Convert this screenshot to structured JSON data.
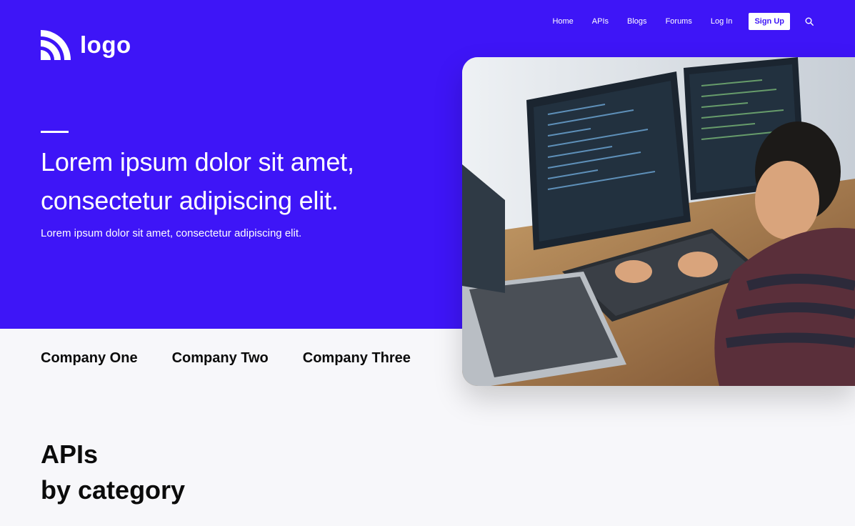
{
  "logo": {
    "text": "logo",
    "icon": "rss-logo-icon"
  },
  "nav": {
    "items": [
      "Home",
      "APIs",
      "Blogs",
      "Forums",
      "Log In"
    ],
    "signup_label": "Sign Up",
    "search_icon": "search-icon"
  },
  "hero": {
    "title_line1": "Lorem ipsum dolor sit amet,",
    "title_line2": "consectetur adipiscing elit.",
    "subtitle": "Lorem ipsum dolor sit amet, consectetur adipiscing elit."
  },
  "companies": [
    "Company One",
    "Company Two",
    "Company Three"
  ],
  "section": {
    "title_line1": "APIs",
    "title_line2": "by category"
  },
  "colors": {
    "brand": "#3e15f7",
    "background": "#f7f7fa",
    "text": "#0b0b0b"
  }
}
